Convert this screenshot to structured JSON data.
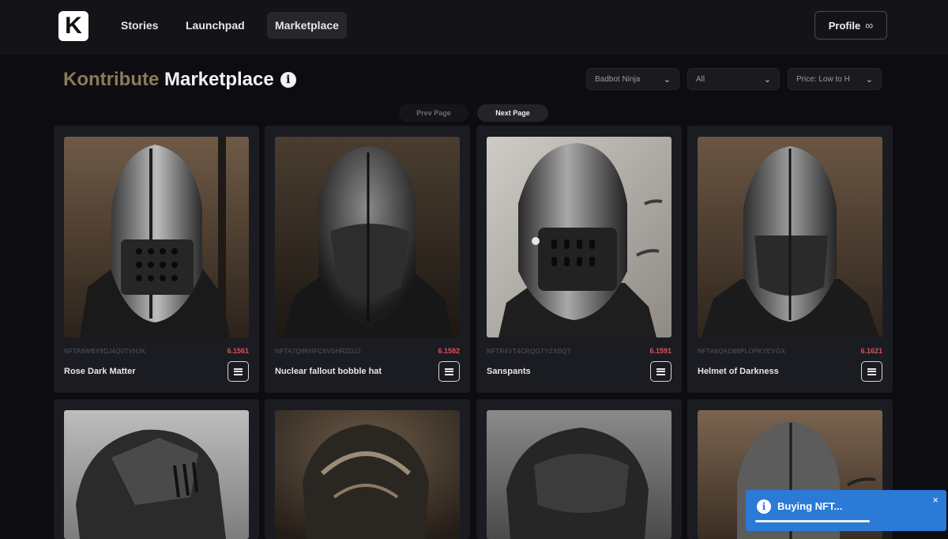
{
  "nav": {
    "logo_letter": "K",
    "items": [
      "Stories",
      "Launchpad",
      "Marketplace"
    ],
    "active": "Marketplace",
    "profile_label": "Profile",
    "profile_icon": "infinity-icon"
  },
  "title": {
    "brand": "Kontribute",
    "rest": "Marketplace",
    "info_icon": "info-icon"
  },
  "filters": {
    "collection": "Badbot Ninja",
    "category": "All",
    "sort": "Price: Low to H"
  },
  "pagination": {
    "prev": "Prev Page",
    "next": "Next Page"
  },
  "cards": [
    {
      "id": "NFTA8WBY9DJ4Q0TVHJK",
      "price": "6.1561",
      "name": "Rose Dark Matter"
    },
    {
      "id": "NFTA7Q8KHFC6VSHRZDJJ",
      "price": "6.1582",
      "name": "Nuclear fallout bobble hat"
    },
    {
      "id": "NFTR4VT4CRQGTYZXBQT",
      "price": "6.1591",
      "name": "Sanspants"
    },
    {
      "id": "NFTA6QAD88PLOPKYEVGX",
      "price": "6.1621",
      "name": "Helmet of Darkness"
    },
    {
      "id": "",
      "price": "",
      "name": ""
    },
    {
      "id": "",
      "price": "",
      "name": ""
    },
    {
      "id": "",
      "price": "",
      "name": ""
    },
    {
      "id": "",
      "price": "",
      "name": ""
    }
  ],
  "toast": {
    "text": "Buying NFT...",
    "close": "×",
    "progress": 0.63,
    "color": "#2a7ad6"
  },
  "colors": {
    "background": "#0d0d11",
    "card": "#1b1c22",
    "brand": "#8b7a5c",
    "price": "#d9525c"
  }
}
